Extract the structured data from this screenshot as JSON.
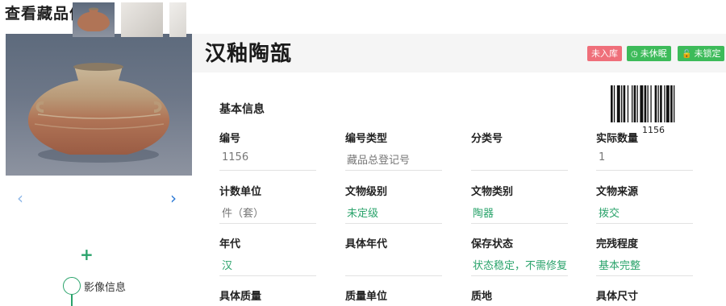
{
  "page": {
    "title": "查看藏品信息"
  },
  "media": {
    "section_label": "影像信息"
  },
  "artifact": {
    "name": "汉釉陶瓿",
    "badges": [
      "未入库",
      "未休眠",
      "未锁定"
    ],
    "section_title": "基本信息",
    "barcode_number": "1156"
  },
  "fields": [
    {
      "label": "编号",
      "value": "1156",
      "value_color": "gray"
    },
    {
      "label": "编号类型",
      "value": "藏品总登记号",
      "value_color": "gray"
    },
    {
      "label": "分类号",
      "value": "",
      "value_color": "gray"
    },
    {
      "label": "实际数量",
      "value": "1",
      "value_color": "gray"
    },
    {
      "label": "计数单位",
      "value": "件（套）",
      "value_color": "gray"
    },
    {
      "label": "文物级别",
      "value": "未定级",
      "value_color": "green"
    },
    {
      "label": "文物类别",
      "value": "陶器",
      "value_color": "green"
    },
    {
      "label": "文物来源",
      "value": "拨交",
      "value_color": "green"
    },
    {
      "label": "年代",
      "value": "汉",
      "value_color": "green"
    },
    {
      "label": "具体年代",
      "value": "",
      "value_color": "gray"
    },
    {
      "label": "保存状态",
      "value": "状态稳定，不需修复",
      "value_color": "green"
    },
    {
      "label": "完残程度",
      "value": "基本完整",
      "value_color": "green"
    },
    {
      "label": "具体质量",
      "value": "",
      "value_color": "gray"
    },
    {
      "label": "质量单位",
      "value": "",
      "value_color": "gray"
    },
    {
      "label": "质地",
      "value": "",
      "value_color": "gray"
    },
    {
      "label": "具体尺寸",
      "value": "",
      "value_color": "gray"
    }
  ],
  "colors": {
    "accent_green": "#2aa36b",
    "badge_red": "#ef6f7a",
    "badge_green": "#3dbb5a",
    "arrow_blue": "#2d7ad6"
  },
  "icons": [
    "chevron-left-icon",
    "chevron-right-icon",
    "plus-icon",
    "clock-icon",
    "lock-icon"
  ]
}
